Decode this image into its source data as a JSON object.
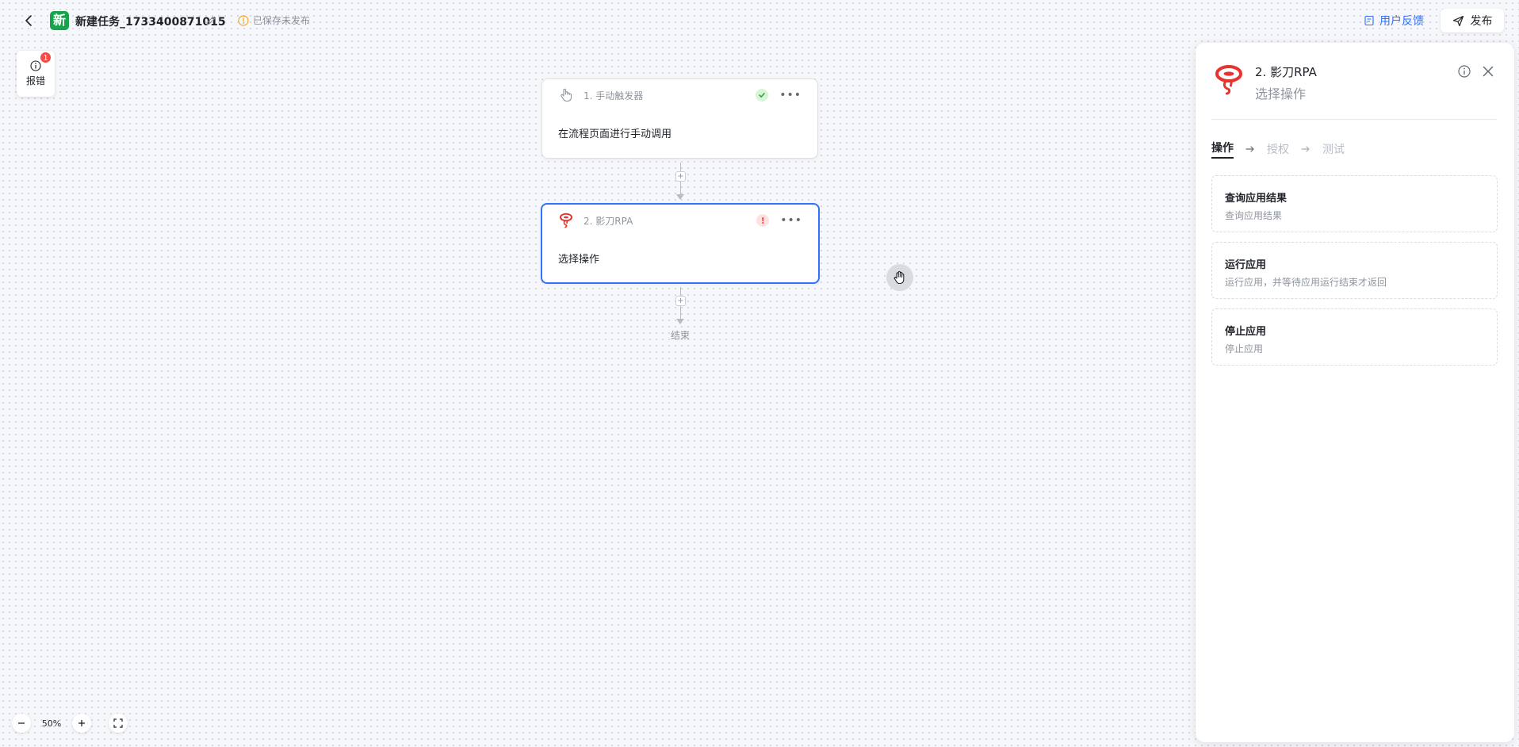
{
  "header": {
    "app_logo_char": "新",
    "task_title": "新建任务_1733400871015",
    "save_status": "已保存未发布",
    "feedback_label": "用户反馈",
    "publish_label": "发布"
  },
  "error_panel": {
    "label": "报错",
    "badge_count": "1"
  },
  "flow": {
    "nodes": [
      {
        "title": "1. 手动触发器",
        "body": "在流程页面进行手动调用",
        "status": "ok"
      },
      {
        "title": "2. 影刀RPA",
        "body": "选择操作",
        "status": "error"
      }
    ],
    "end_label": "结束"
  },
  "zoom": {
    "level": "50%"
  },
  "panel": {
    "title": "2. 影刀RPA",
    "subtitle": "选择操作",
    "steps": [
      "操作",
      "授权",
      "测试"
    ],
    "operations": [
      {
        "title": "查询应用结果",
        "desc": "查询应用结果"
      },
      {
        "title": "运行应用",
        "desc": "运行应用，并等待应用运行结束才返回"
      },
      {
        "title": "停止应用",
        "desc": "停止应用"
      }
    ]
  },
  "colors": {
    "accent": "#3370ff",
    "brand_green": "#16a34a",
    "error_red": "#f54a45",
    "warning_orange": "#f5a623"
  }
}
